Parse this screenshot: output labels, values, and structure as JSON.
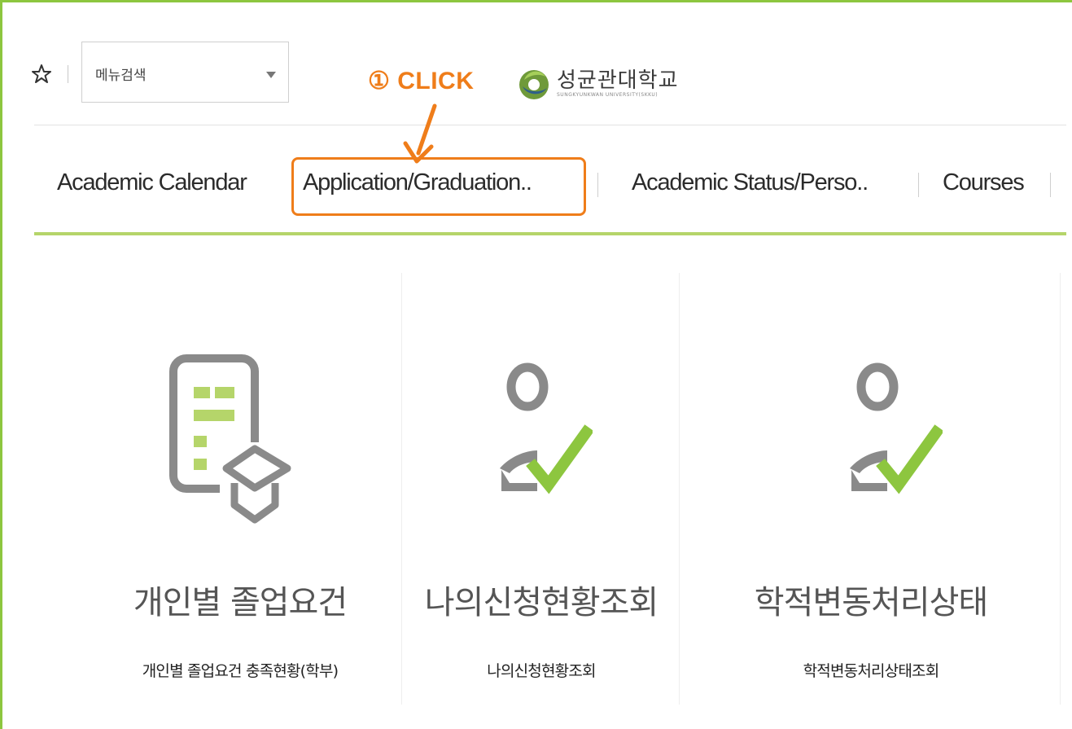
{
  "header": {
    "menu_search_label": "메뉴검색",
    "annotation_label": "① CLICK",
    "logo_text": "성균관대학교",
    "logo_subtext": "SUNGKYUNKWAN UNIVERSITY(SKKU)"
  },
  "nav": {
    "items": [
      {
        "label": "Academic Calendar"
      },
      {
        "label": "Application/Graduation.."
      },
      {
        "label": "Academic Status/Perso.."
      },
      {
        "label": "Courses"
      }
    ],
    "highlighted_index": 1
  },
  "cards": [
    {
      "icon": "graduation-document-icon",
      "title": "개인별 졸업요건",
      "desc": "개인별 졸업요건 충족현황(학부)"
    },
    {
      "icon": "user-check-icon",
      "title": "나의신청현황조회",
      "desc": "나의신청현황조회"
    },
    {
      "icon": "user-check-icon",
      "title": "학적변동처리상태",
      "desc": "학적변동처리상태조회"
    }
  ],
  "colors": {
    "accent_green": "#8dc63f",
    "highlight_orange": "#ef7d1a",
    "icon_gray": "#8a8a8a"
  }
}
